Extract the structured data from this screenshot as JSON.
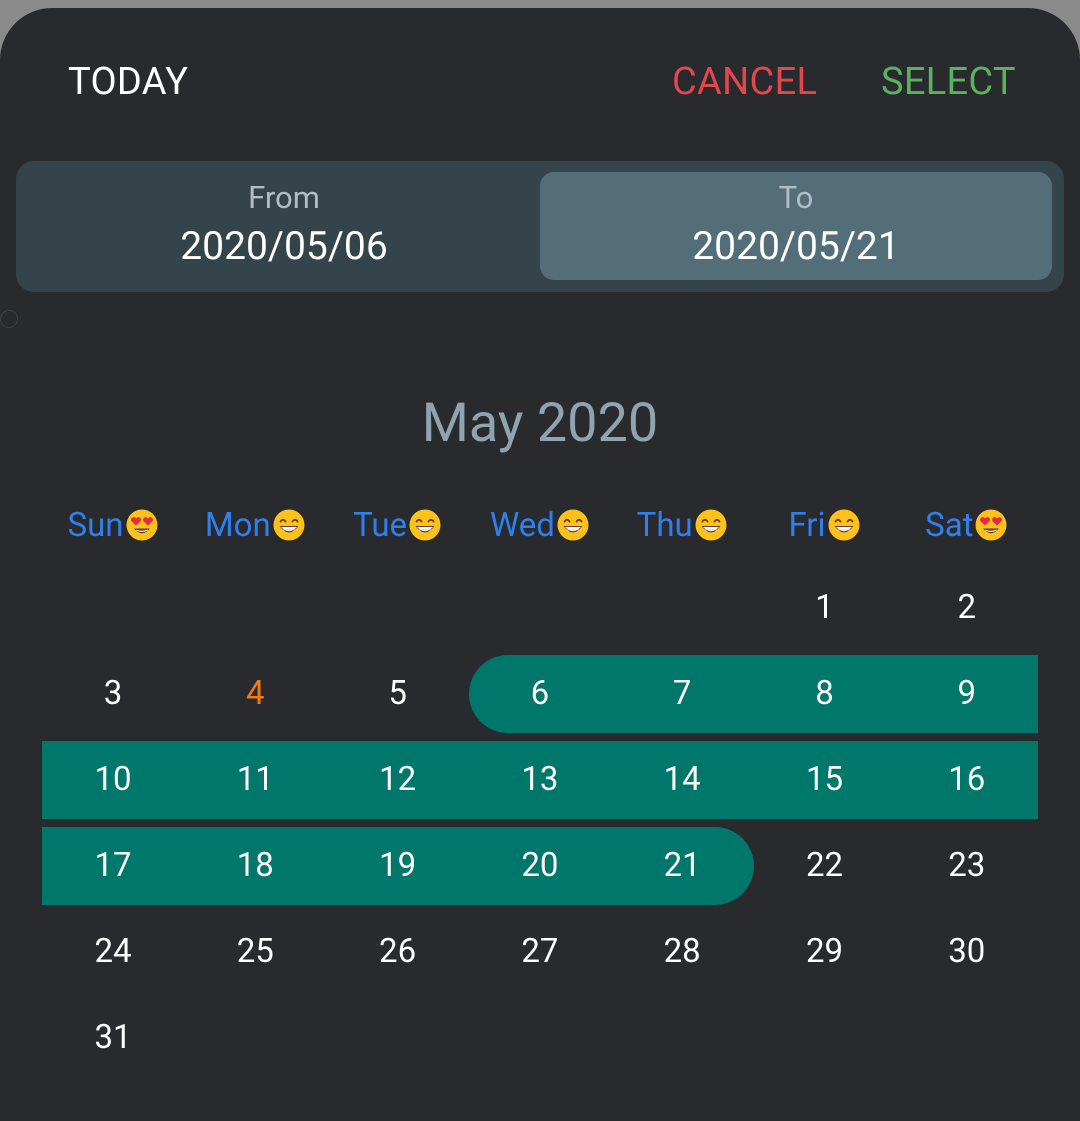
{
  "actions": {
    "today": "TODAY",
    "cancel": "CANCEL",
    "select": "SELECT"
  },
  "range": {
    "from_label": "From",
    "from_value": "2020/05/06",
    "to_label": "To",
    "to_value": "2020/05/21"
  },
  "calendar": {
    "month_title": "May 2020",
    "weekdays": [
      {
        "label": "Sun",
        "emoji": "heart-eyes-emoji"
      },
      {
        "label": "Mon",
        "emoji": "grinning-emoji"
      },
      {
        "label": "Tue",
        "emoji": "grinning-emoji"
      },
      {
        "label": "Wed",
        "emoji": "grinning-emoji"
      },
      {
        "label": "Thu",
        "emoji": "grinning-emoji"
      },
      {
        "label": "Fri",
        "emoji": "grinning-emoji"
      },
      {
        "label": "Sat",
        "emoji": "heart-eyes-emoji"
      }
    ],
    "first_weekday_index": 5,
    "days_in_month": 31,
    "selected_start": 6,
    "selected_end": 21,
    "highlighted_days": [
      4
    ]
  },
  "colors": {
    "background": "#282a2e",
    "cancel": "#e0484b",
    "select": "#59b35d",
    "weekday": "#2f80ed",
    "selection": "#00776b",
    "holiday": "#ef7a18",
    "month_title": "#90a4ae"
  }
}
